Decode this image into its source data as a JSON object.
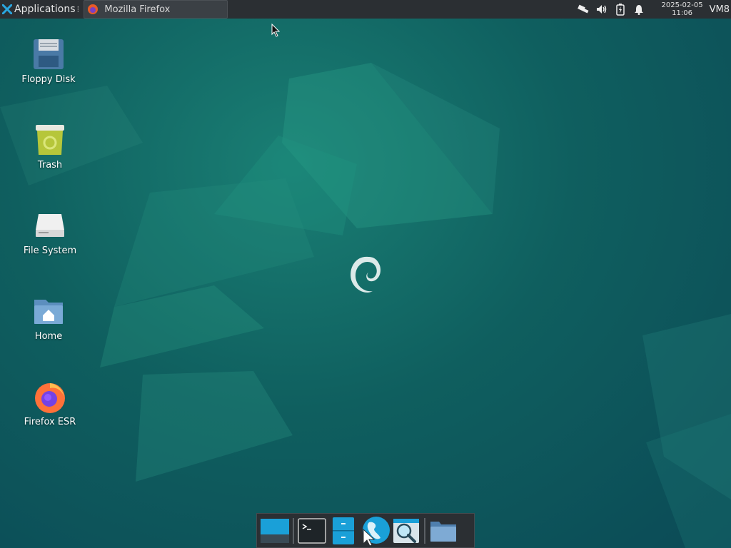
{
  "top_panel": {
    "applications_label": "Applications",
    "applications_separator": "⁝",
    "active_window_title": "Mozilla Firefox",
    "clock_date": "2025-02-05",
    "clock_time": "11:06",
    "user_label": "VM8"
  },
  "tray_icons": [
    "network-icon",
    "volume-icon",
    "battery-icon",
    "notification-bell-icon"
  ],
  "desktop_icons": [
    {
      "name": "floppy-disk-icon",
      "label": "Floppy Disk"
    },
    {
      "name": "trash-icon",
      "label": "Trash"
    },
    {
      "name": "file-system-icon",
      "label": "File System"
    },
    {
      "name": "home-folder-icon",
      "label": "Home"
    },
    {
      "name": "firefox-esr-icon",
      "label": "Firefox ESR"
    }
  ],
  "dock_items": [
    "show-desktop",
    "terminal",
    "file-manager",
    "web-browser",
    "app-finder",
    "folder"
  ],
  "colors": {
    "panel_bg": "#2b2f33",
    "wallpaper_base": "#0f5f5f",
    "accent": "#1aa0d8"
  }
}
